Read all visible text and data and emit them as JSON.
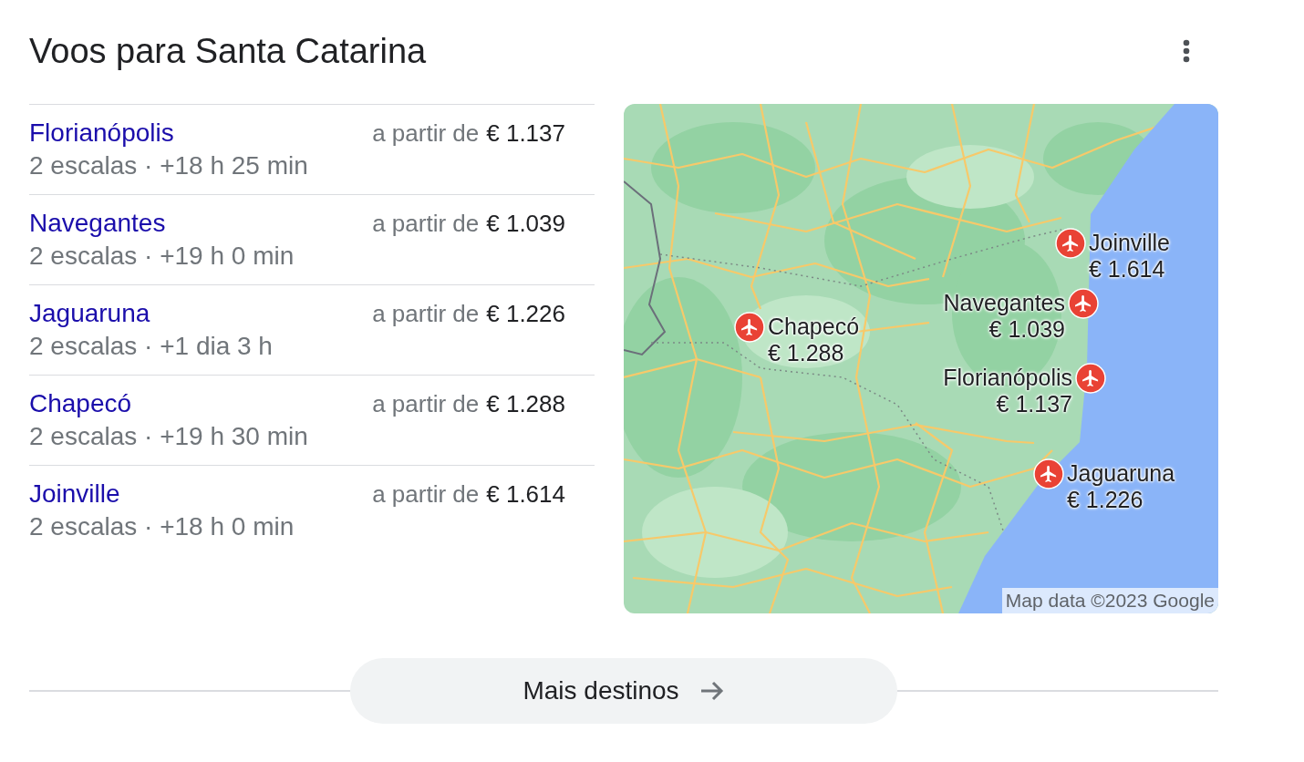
{
  "header": {
    "title": "Voos para Santa Catarina"
  },
  "destinations": [
    {
      "name": "Florianópolis",
      "details": "2 escalas · +18 h 25 min",
      "price_prefix": "a partir de",
      "price": "€ 1.137"
    },
    {
      "name": "Navegantes",
      "details": "2 escalas · +19 h 0 min",
      "price_prefix": "a partir de",
      "price": "€ 1.039"
    },
    {
      "name": "Jaguaruna",
      "details": "2 escalas · +1 dia 3 h",
      "price_prefix": "a partir de",
      "price": "€ 1.226"
    },
    {
      "name": "Chapecó",
      "details": "2 escalas · +19 h 30 min",
      "price_prefix": "a partir de",
      "price": "€ 1.288"
    },
    {
      "name": "Joinville",
      "details": "2 escalas · +18 h 0 min",
      "price_prefix": "a partir de",
      "price": "€ 1.614"
    }
  ],
  "map": {
    "markers": [
      {
        "name": "Joinville",
        "price": "€ 1.614"
      },
      {
        "name": "Navegantes",
        "price": "€ 1.039"
      },
      {
        "name": "Chapecó",
        "price": "€ 1.288"
      },
      {
        "name": "Florianópolis",
        "price": "€ 1.137"
      },
      {
        "name": "Jaguaruna",
        "price": "€ 1.226"
      }
    ],
    "attribution": "Map data ©2023 Google"
  },
  "more_button": {
    "label": "Mais destinos"
  }
}
